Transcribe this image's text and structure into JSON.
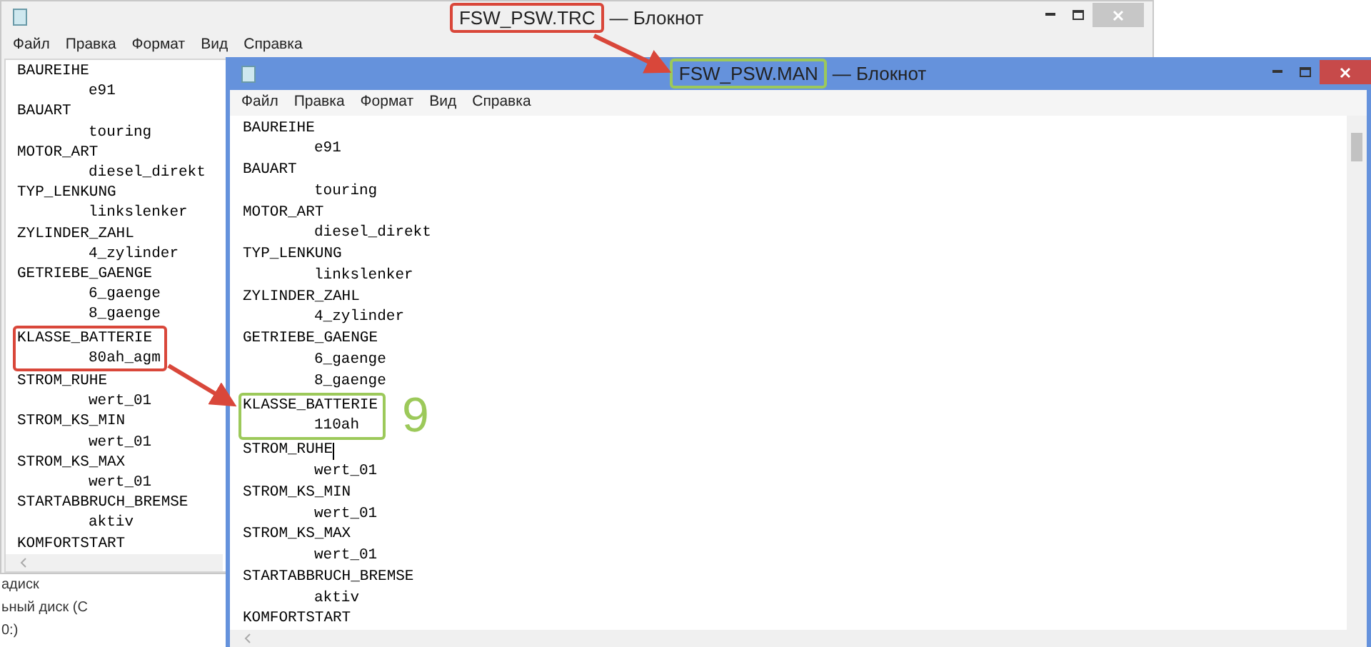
{
  "back_window": {
    "title": {
      "file": "FSW_PSW.TRC",
      "color": "#d9473a"
    },
    "title_app": "— Блокнот",
    "menu": [
      "Файл",
      "Правка",
      "Формат",
      "Вид",
      "Справка"
    ],
    "entries": [
      {
        "key": "BAUREIHE",
        "values": [
          "e91"
        ]
      },
      {
        "key": "BAUART",
        "values": [
          "touring"
        ]
      },
      {
        "key": "MOTOR_ART",
        "values": [
          "diesel_direkt"
        ]
      },
      {
        "key": "TYP_LENKUNG",
        "values": [
          "linkslenker"
        ]
      },
      {
        "key": "ZYLINDER_ZAHL",
        "values": [
          "4_zylinder"
        ]
      },
      {
        "key": "GETRIEBE_GAENGE",
        "values": [
          "6_gaenge",
          "8_gaenge"
        ]
      },
      {
        "key": "KLASSE_BATTERIE",
        "values": [
          "80ah_agm"
        ],
        "color": "#d9473a"
      },
      {
        "key": "STROM_RUHE",
        "values": [
          "wert_01"
        ]
      },
      {
        "key": "STROM_KS_MIN",
        "values": [
          "wert_01"
        ]
      },
      {
        "key": "STROM_KS_MAX",
        "values": [
          "wert_01"
        ]
      },
      {
        "key": "STARTABBRUCH_BREMSE",
        "values": [
          "aktiv"
        ]
      },
      {
        "key": "KOMFORTSTART"
      }
    ]
  },
  "explorer_fragment": [
    "адиск",
    "ьный диск (С",
    "0:)"
  ],
  "front_window": {
    "title": {
      "file": "FSW_PSW.MAN",
      "color": "#9cc95a"
    },
    "title_app": "— Блокнот",
    "menu": [
      "Файл",
      "Правка",
      "Формат",
      "Вид",
      "Справка"
    ],
    "entries": [
      {
        "key": "BAUREIHE",
        "values": [
          "e91"
        ]
      },
      {
        "key": "BAUART",
        "values": [
          "touring"
        ]
      },
      {
        "key": "MOTOR_ART",
        "values": [
          "diesel_direkt"
        ]
      },
      {
        "key": "TYP_LENKUNG",
        "values": [
          "linkslenker"
        ]
      },
      {
        "key": "ZYLINDER_ZAHL",
        "values": [
          "4_zylinder"
        ]
      },
      {
        "key": "GETRIEBE_GAENGE",
        "values": [
          "6_gaenge",
          "8_gaenge"
        ]
      },
      {
        "key": "KLASSE_BATTERIE",
        "values": [
          "110ah"
        ],
        "color": "#9cc95a",
        "note": "9"
      },
      {
        "key": "STROM_RUHE",
        "values": [
          "wert_01"
        ],
        "caret": true
      },
      {
        "key": "STROM_KS_MIN",
        "values": [
          "wert_01"
        ]
      },
      {
        "key": "STROM_KS_MAX",
        "values": [
          "wert_01"
        ]
      },
      {
        "key": "STARTABBRUCH_BREMSE",
        "values": [
          "aktiv"
        ]
      },
      {
        "key": "KOMFORTSTART"
      }
    ]
  }
}
